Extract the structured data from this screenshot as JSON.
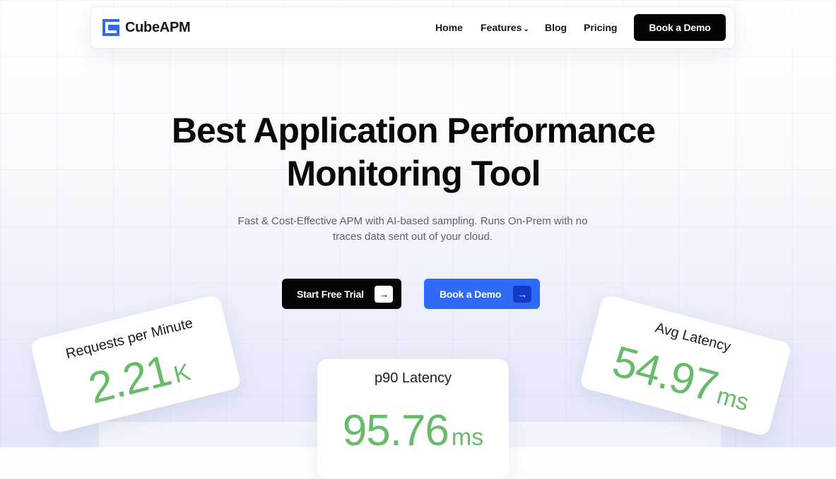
{
  "brand": {
    "name": "CubeAPM",
    "accent": "#2f6bf6"
  },
  "nav": {
    "items": [
      "Home",
      "Features",
      "Blog",
      "Pricing"
    ],
    "cta_label": "Book a Demo"
  },
  "hero": {
    "title_line1": "Best Application Performance",
    "title_line2": "Monitoring Tool",
    "subtitle_line1": "Fast & Cost-Effective APM with AI-based sampling. Runs On-Prem with no",
    "subtitle_line2": "traces data sent out of your cloud.",
    "primary_cta": "Start Free Trial",
    "secondary_cta": "Book a Demo"
  },
  "metrics": {
    "requests": {
      "label": "Requests per Minute",
      "value": "2.21",
      "unit": "K"
    },
    "p90": {
      "label": "p90 Latency",
      "value": "95.76",
      "unit": "ms"
    },
    "avg": {
      "label": "Avg Latency",
      "value": "54.97",
      "unit": "ms"
    }
  },
  "colors": {
    "metric_green": "#67bb6a",
    "dark": "#050505",
    "blue": "#2f6bf6"
  },
  "icons": [
    "logo-icon",
    "chevron-down-icon",
    "arrow-right-icon"
  ]
}
